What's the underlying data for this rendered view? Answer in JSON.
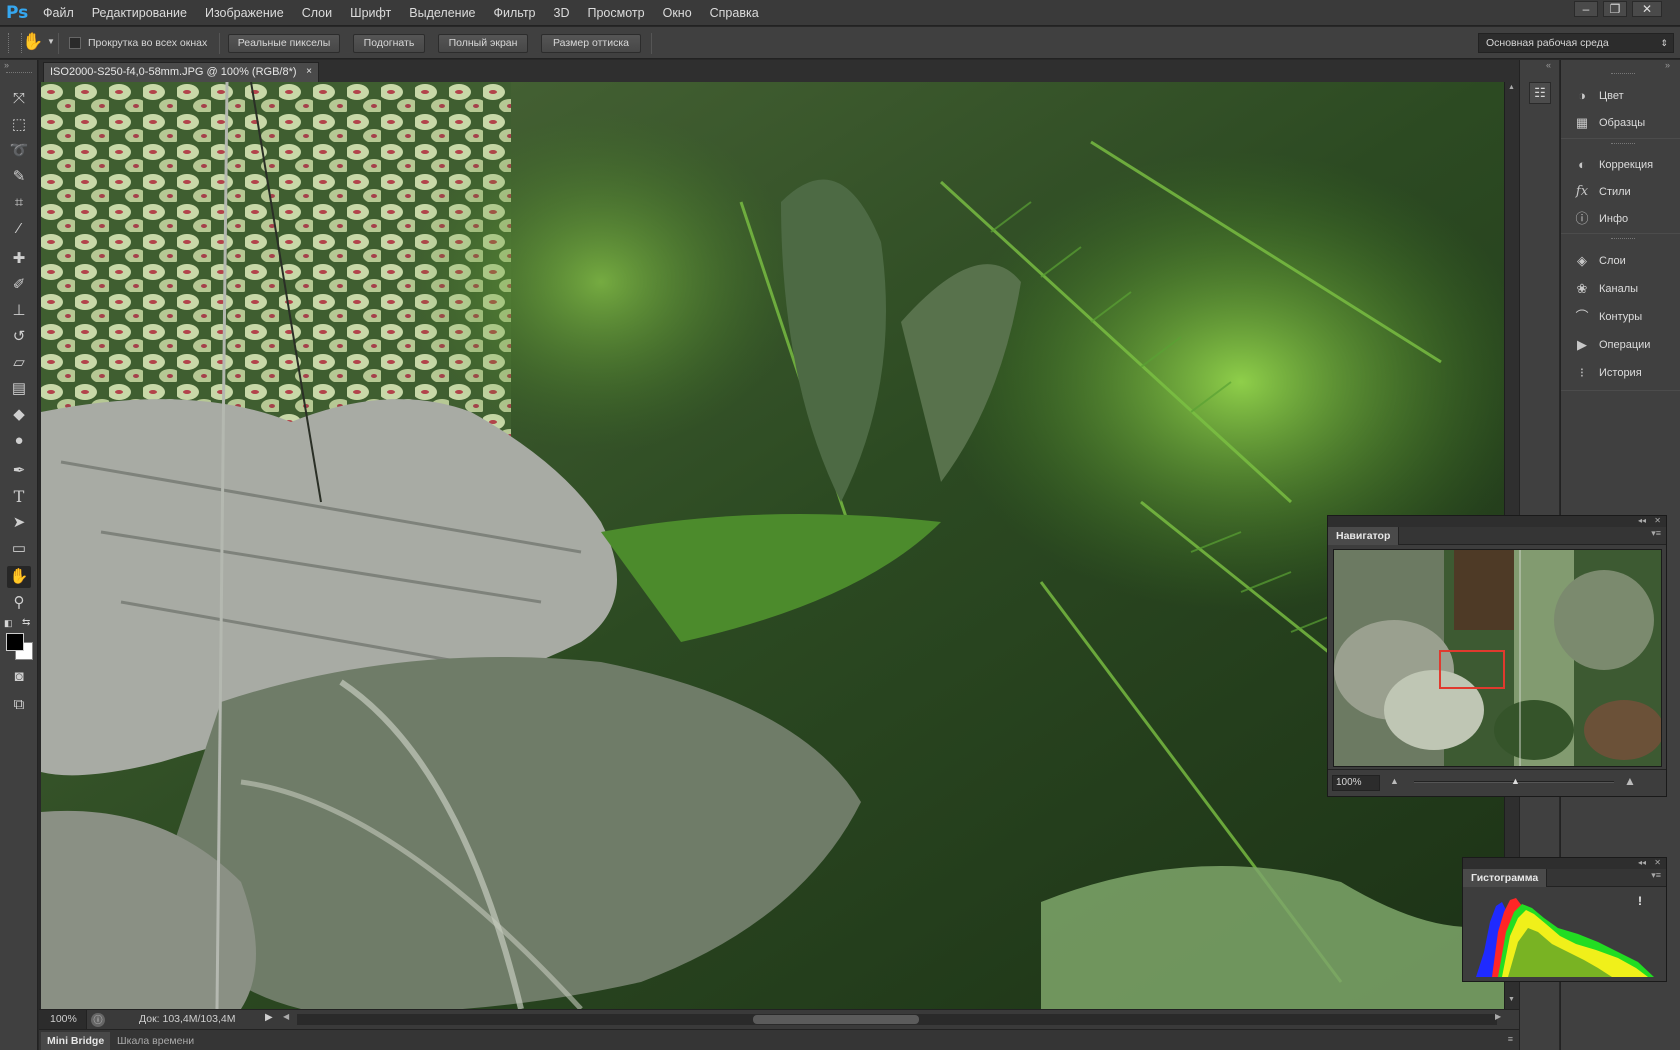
{
  "app": {
    "logo": "Ps"
  },
  "menu": [
    "Файл",
    "Редактирование",
    "Изображение",
    "Слои",
    "Шрифт",
    "Выделение",
    "Фильтр",
    "3D",
    "Просмотр",
    "Окно",
    "Справка"
  ],
  "options": {
    "scroll_all_label": "Прокрутка во всех окнах",
    "buttons": [
      "Реальные пикселы",
      "Подогнать",
      "Полный экран",
      "Размер оттиска"
    ],
    "workspace": "Основная рабочая среда"
  },
  "document": {
    "tab_title": "ISO2000-S250-f4,0-58mm.JPG @ 100% (RGB/8*)",
    "zoom": "100%",
    "doc_size": "Док: 103,4M/103,4M"
  },
  "bottom_tabs": [
    "Mini Bridge",
    "Шкала времени"
  ],
  "dock": {
    "group1": [
      {
        "label": "Цвет",
        "icon": "color-wheel-icon"
      },
      {
        "label": "Образцы",
        "icon": "swatches-grid-icon"
      }
    ],
    "group2": [
      {
        "label": "Коррекция",
        "icon": "adjustment-icon"
      },
      {
        "label": "Стили",
        "icon": "fx-icon"
      },
      {
        "label": "Инфо",
        "icon": "info-icon"
      }
    ],
    "group3": [
      {
        "label": "Слои",
        "icon": "layers-icon"
      },
      {
        "label": "Каналы",
        "icon": "channels-icon"
      },
      {
        "label": "Контуры",
        "icon": "paths-icon"
      },
      {
        "label": "Операции",
        "icon": "play-icon"
      },
      {
        "label": "История",
        "icon": "history-icon"
      }
    ]
  },
  "navigator": {
    "title": "Навигатор",
    "zoom": "100%"
  },
  "histogram": {
    "title": "Гистограмма",
    "warning": "!"
  },
  "colors": {
    "accent_blue": "#35a7f0",
    "nav_box": "#e03a2e"
  }
}
